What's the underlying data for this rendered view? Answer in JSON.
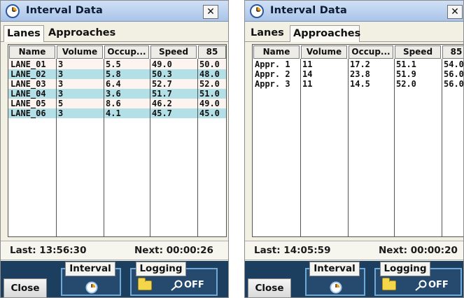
{
  "panels": [
    {
      "title": "Interval Data",
      "tabs": [
        "Lanes",
        "Approaches"
      ],
      "active_tab": "Lanes",
      "columns": [
        "Name",
        "Volume",
        "Occup...",
        "Speed",
        "85"
      ],
      "rows": [
        {
          "name": "LANE_01",
          "volume": "3",
          "occupancy": "5.5",
          "speed": "49.0",
          "p85": "50.0",
          "highlight": false
        },
        {
          "name": "LANE_02",
          "volume": "3",
          "occupancy": "5.8",
          "speed": "50.3",
          "p85": "48.0",
          "highlight": true
        },
        {
          "name": "LANE_03",
          "volume": "3",
          "occupancy": "6.4",
          "speed": "52.7",
          "p85": "52.0",
          "highlight": false
        },
        {
          "name": "LANE_04",
          "volume": "3",
          "occupancy": "3.6",
          "speed": "51.7",
          "p85": "51.0",
          "highlight": true
        },
        {
          "name": "LANE_05",
          "volume": "5",
          "occupancy": "8.6",
          "speed": "46.2",
          "p85": "49.0",
          "highlight": false
        },
        {
          "name": "LANE_06",
          "volume": "3",
          "occupancy": "4.1",
          "speed": "45.7",
          "p85": "45.0",
          "highlight": true
        }
      ],
      "last": "Last: 13:56:30",
      "next": "Next: 00:00:26",
      "close_label": "Close",
      "interval_label": "Interval",
      "logging_label": "Logging",
      "off_label": "OFF"
    },
    {
      "title": "Interval Data",
      "tabs": [
        "Lanes",
        "Approaches"
      ],
      "active_tab": "Approaches",
      "columns": [
        "Name",
        "Volume",
        "Occup...",
        "Speed",
        "85"
      ],
      "rows": [
        {
          "name": "Appr. 1",
          "volume": "11",
          "occupancy": "17.2",
          "speed": "51.1",
          "p85": "54.0",
          "highlight": false
        },
        {
          "name": "Appr. 2",
          "volume": "14",
          "occupancy": "23.8",
          "speed": "51.9",
          "p85": "56.0",
          "highlight": false
        },
        {
          "name": "Appr. 3",
          "volume": "11",
          "occupancy": "14.5",
          "speed": "52.0",
          "p85": "56.0",
          "highlight": false
        }
      ],
      "last": "Last: 14:05:59",
      "next": "Next: 00:00:20",
      "close_label": "Close",
      "interval_label": "Interval",
      "logging_label": "Logging",
      "off_label": "OFF"
    }
  ],
  "colors": {
    "row_highlight": "#b3e0e6",
    "row_alt": "#fdf4ef",
    "titlebar": "#b9cfee",
    "bottom_bar": "#1d3f5f",
    "group_border": "#6fa9d8"
  }
}
